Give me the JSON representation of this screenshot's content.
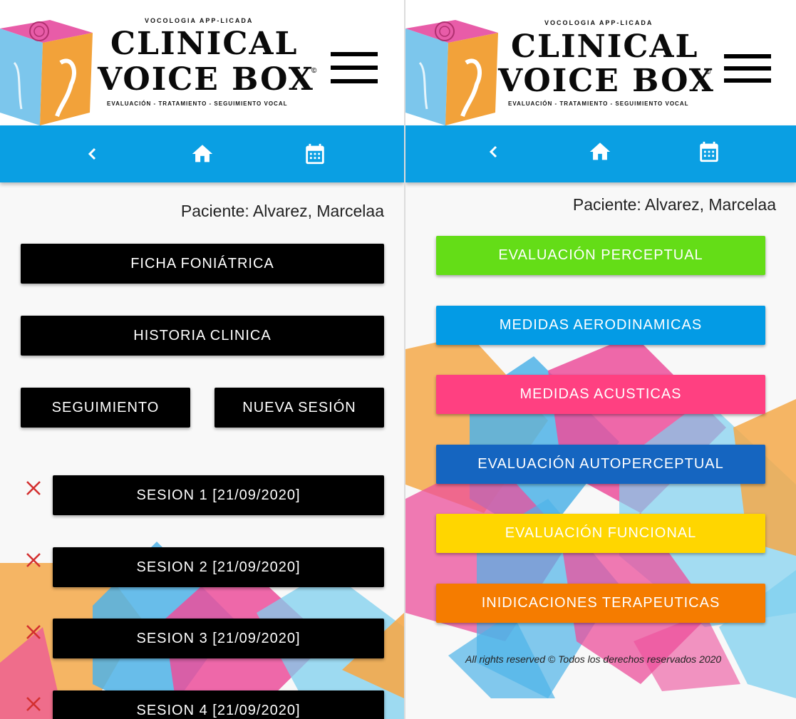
{
  "brand": {
    "top_text": "VOCOLOGIA APP-LICADA",
    "line1": "CLINICAL",
    "line2": "VOICE BOX",
    "copyright": "©",
    "subtitle": "EVALUACIÓN - TRATAMIENTO - SEGUIMIENTO VOCAL"
  },
  "nav": {
    "back_icon": "chevron-left-icon",
    "home_icon": "home-icon",
    "calendar_icon": "calendar-icon",
    "bar_color": "#0a9fe3"
  },
  "left_screen": {
    "patient": "Paciente: Alvarez, Marcelaa",
    "buttons": {
      "ficha": "FICHA FONIÁTRICA",
      "historia": "HISTORIA CLINICA",
      "seguimiento": "SEGUIMIENTO",
      "nueva_sesion": "NUEVA SESIÓN"
    },
    "sessions": [
      "SESION 1 [21/09/2020]",
      "SESION 2 [21/09/2020]",
      "SESION 3 [21/09/2020]",
      "SESION 4 [21/09/2020]"
    ],
    "delete_icon": "close-icon",
    "delete_color": "#d32f2f"
  },
  "right_screen": {
    "patient": "Paciente: Alvarez, Marcelaa",
    "menu": [
      {
        "label": "EVALUACIÓN PERCEPTUAL",
        "color": "#64dd17"
      },
      {
        "label": "MEDIDAS AERODINAMICAS",
        "color": "#039be5"
      },
      {
        "label": "MEDIDAS ACUSTICAS",
        "color": "#ff4081"
      },
      {
        "label": "EVALUACIÓN AUTOPERCEPTUAL",
        "color": "#1565c0"
      },
      {
        "label": "EVALUACIÓN FUNCIONAL",
        "color": "#ffd600"
      },
      {
        "label": "INIDICACIONES TERAPEUTICAS",
        "color": "#f57c00"
      }
    ],
    "footer": "All rights reserved © Todos los derechos reservados 2020"
  }
}
